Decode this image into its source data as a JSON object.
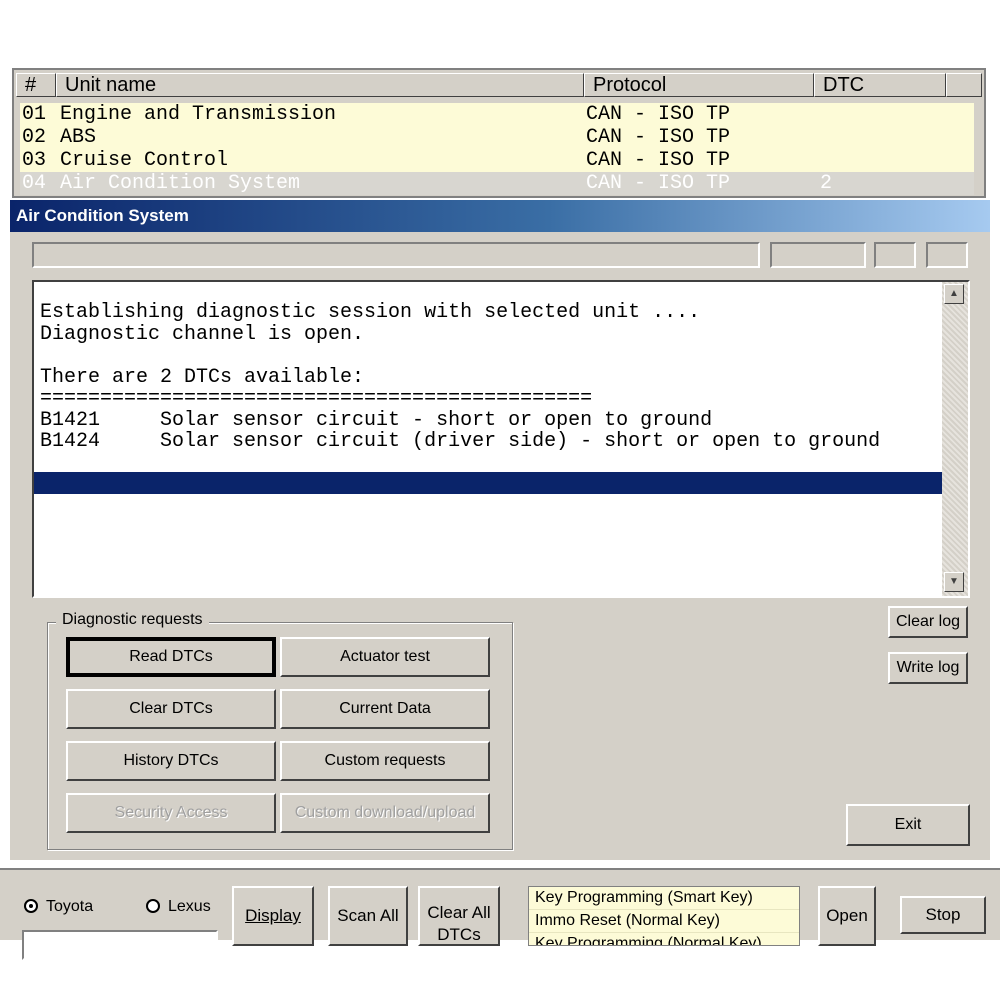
{
  "unit_list": {
    "headers": [
      "#",
      "Unit name",
      "Protocol",
      "DTC"
    ],
    "rows": [
      {
        "num": "01",
        "name": "Engine and Transmission",
        "protocol": "CAN - ISO TP",
        "dtc": ""
      },
      {
        "num": "02",
        "name": "ABS",
        "protocol": "CAN - ISO TP",
        "dtc": ""
      },
      {
        "num": "03",
        "name": "Cruise Control",
        "protocol": "CAN - ISO TP",
        "dtc": ""
      },
      {
        "num": "04",
        "name": "Air Condition System",
        "protocol": "CAN - ISO TP",
        "dtc": "2"
      }
    ]
  },
  "dialog": {
    "title": "Air Condition System",
    "log_lines": [
      "Establishing diagnostic session with selected unit ....",
      "Diagnostic channel is open.",
      "",
      "There are 2 DTCs available:",
      "==============================================",
      "B1421     Solar sensor circuit - short or open to ground",
      "B1424     Solar sensor circuit (driver side) - short or open to ground"
    ],
    "group_label": "Diagnostic requests",
    "buttons": {
      "read_dtcs": "Read DTCs",
      "actuator_test": "Actuator test",
      "clear_dtcs": "Clear DTCs",
      "current_data": "Current Data",
      "history_dtcs": "History DTCs",
      "custom_requests": "Custom requests",
      "security_access": "Security Access",
      "custom_download_upload": "Custom download/upload",
      "clear_log": "Clear log",
      "write_log": "Write log",
      "exit": "Exit"
    }
  },
  "bottom": {
    "radio_toyota": "Toyota",
    "radio_lexus": "Lexus",
    "display": "Display",
    "scan_all": "Scan All",
    "clear_all_dtcs": "Clear All DTCs",
    "key_options": [
      "Key Programming (Smart Key)",
      "Immo Reset (Normal Key)",
      "Key Programming (Normal Key)"
    ],
    "open": "Open",
    "stop": "Stop"
  }
}
